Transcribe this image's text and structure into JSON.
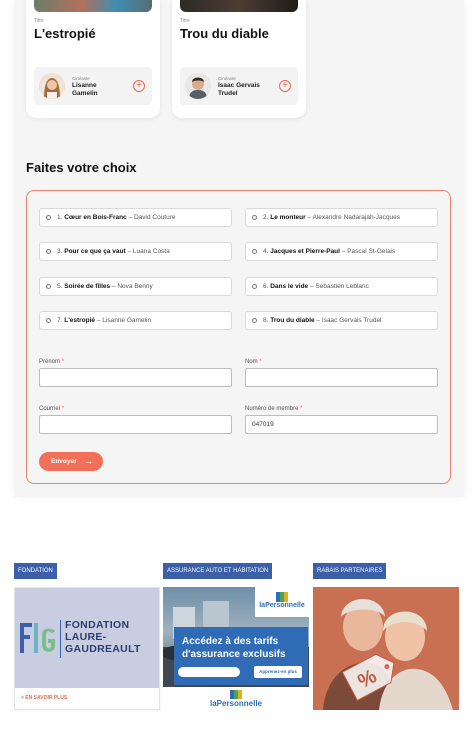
{
  "cards": [
    {
      "title_label": "Titre",
      "title": "L'estropié",
      "author_label": "Cinéaste",
      "author": "Lisanne Gamelin"
    },
    {
      "title_label": "Titre",
      "title": "Trou du diable",
      "author_label": "Cinéaste",
      "author": "Isaac Gervais Trudel"
    }
  ],
  "choice": {
    "heading": "Faites votre choix",
    "options": [
      {
        "num": "1.",
        "title": "Cœur en Bois-Franc",
        "author": "– David Couture"
      },
      {
        "num": "2.",
        "title": "Le monteur",
        "author": "– Alexandre Nadarajah-Jacques"
      },
      {
        "num": "3.",
        "title": "Pour ce que ça vaut",
        "author": "– Luana Costa"
      },
      {
        "num": "4.",
        "title": "Jacques et Pierre-Paul",
        "author": "– Pascal St-Gelais"
      },
      {
        "num": "5.",
        "title": "Soirée de filles",
        "author": "– Nova Benny"
      },
      {
        "num": "6.",
        "title": "Dans le vide",
        "author": "– Sebastien Leblanc"
      },
      {
        "num": "7.",
        "title": "L'estropié",
        "author": "– Lisanne Gamelin"
      },
      {
        "num": "8.",
        "title": "Trou du diable",
        "author": "– Isaac Gervais Trudel"
      }
    ],
    "fields": {
      "prenom": {
        "label": "Prénom",
        "value": ""
      },
      "nom": {
        "label": "Nom",
        "value": ""
      },
      "courriel": {
        "label": "Courriel",
        "value": ""
      },
      "membre": {
        "label": "Numéro de membre",
        "value": "047019"
      }
    },
    "required_mark": "*",
    "submit_label": "Envoyer"
  },
  "promos": [
    {
      "tag": "FONDATION",
      "org_line1": "FONDATION",
      "org_line2": "LAURE-",
      "org_line3": "GAUDREAULT",
      "link": "> EN SAVOIR PLUS"
    },
    {
      "tag": "ASSURANCE AUTO ET HABITATION",
      "brand": "laPersonnelle",
      "headline1": "Accédez à des tarifs",
      "headline2": "d'assurance exclusifs",
      "cta": "Apprenez-en plus"
    },
    {
      "tag": "RABAIS PARTENAIRES"
    }
  ],
  "colors": {
    "accent": "#f0705a",
    "tag_blue": "#3b5fa8",
    "ad_blue": "#2f6cb5"
  }
}
